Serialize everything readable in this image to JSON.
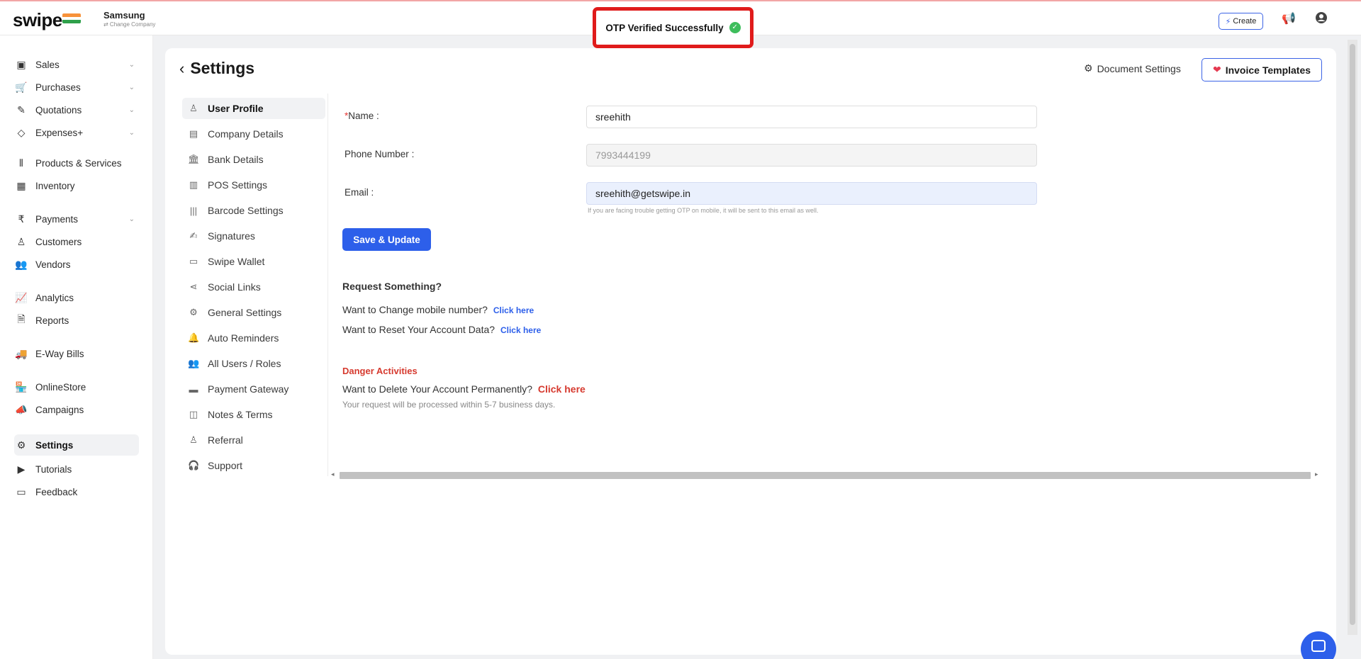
{
  "header": {
    "logo": "swipe",
    "company_name": "Samsung",
    "change_company": "⇄ Change Company",
    "create_label": "Create"
  },
  "toast": {
    "message": "OTP Verified Successfully",
    "icon": "check-circle-icon",
    "color": "#3ebd5c"
  },
  "sidebar": {
    "items": [
      {
        "label": "Sales",
        "icon": "cash-icon",
        "has_submenu": true
      },
      {
        "label": "Purchases",
        "icon": "cart-icon",
        "has_submenu": true
      },
      {
        "label": "Quotations",
        "icon": "pencil-icon",
        "has_submenu": true
      },
      {
        "label": "Expenses+",
        "icon": "tag-icon",
        "has_submenu": true
      },
      {
        "label": "Products & Services",
        "icon": "barcode-scan-icon",
        "has_submenu": false
      },
      {
        "label": "Inventory",
        "icon": "warehouse-icon",
        "has_submenu": false
      },
      {
        "label": "Payments",
        "icon": "rupee-icon",
        "has_submenu": true
      },
      {
        "label": "Customers",
        "icon": "user-icon",
        "has_submenu": false
      },
      {
        "label": "Vendors",
        "icon": "users-icon",
        "has_submenu": false
      },
      {
        "label": "Analytics",
        "icon": "chart-line-icon",
        "has_submenu": false
      },
      {
        "label": "Reports",
        "icon": "report-icon",
        "has_submenu": false
      },
      {
        "label": "E-Way Bills",
        "icon": "truck-icon",
        "has_submenu": false
      },
      {
        "label": "OnlineStore",
        "icon": "store-icon",
        "has_submenu": false
      },
      {
        "label": "Campaigns",
        "icon": "megaphone-icon",
        "has_submenu": false
      },
      {
        "label": "Settings",
        "icon": "settings-gear-icon",
        "has_submenu": false,
        "active": true
      },
      {
        "label": "Tutorials",
        "icon": "youtube-icon",
        "has_submenu": false
      },
      {
        "label": "Feedback",
        "icon": "message-icon",
        "has_submenu": false
      }
    ]
  },
  "page": {
    "title": "Settings",
    "document_settings_label": "Document Settings",
    "invoice_templates_label": "Invoice Templates"
  },
  "settings_menu": {
    "items": [
      {
        "label": "User Profile",
        "icon": "user-icon",
        "active": true
      },
      {
        "label": "Company Details",
        "icon": "building-icon"
      },
      {
        "label": "Bank Details",
        "icon": "bank-icon"
      },
      {
        "label": "POS Settings",
        "icon": "pos-icon"
      },
      {
        "label": "Barcode Settings",
        "icon": "barcode-icon"
      },
      {
        "label": "Signatures",
        "icon": "signature-icon"
      },
      {
        "label": "Swipe Wallet",
        "icon": "wallet-icon"
      },
      {
        "label": "Social Links",
        "icon": "share-icon"
      },
      {
        "label": "General Settings",
        "icon": "gear-icon"
      },
      {
        "label": "Auto Reminders",
        "icon": "bell-icon"
      },
      {
        "label": "All Users / Roles",
        "icon": "users-icon"
      },
      {
        "label": "Payment Gateway",
        "icon": "card-icon"
      },
      {
        "label": "Notes & Terms",
        "icon": "note-icon"
      },
      {
        "label": "Referral",
        "icon": "referral-icon"
      },
      {
        "label": "Support",
        "icon": "headset-icon"
      }
    ]
  },
  "profile_form": {
    "name_label": "Name",
    "name_value": "sreehith",
    "phone_label": "Phone Number",
    "phone_value": "7993444199",
    "email_label": "Email",
    "email_value": "sreehith@getswipe.in",
    "email_hint": "If you are facing trouble getting OTP on mobile, it will be sent to this email as well.",
    "save_label": "Save & Update"
  },
  "requests": {
    "heading": "Request Something?",
    "change_mobile_text": "Want to Change mobile number?",
    "change_mobile_link": "Click here",
    "reset_data_text": "Want to Reset Your Account Data?",
    "reset_data_link": "Click here"
  },
  "danger": {
    "heading": "Danger Activities",
    "delete_text": "Want to Delete Your Account Permanently?",
    "delete_link": "Click here",
    "note": "Your request will be processed within 5-7 business days."
  }
}
